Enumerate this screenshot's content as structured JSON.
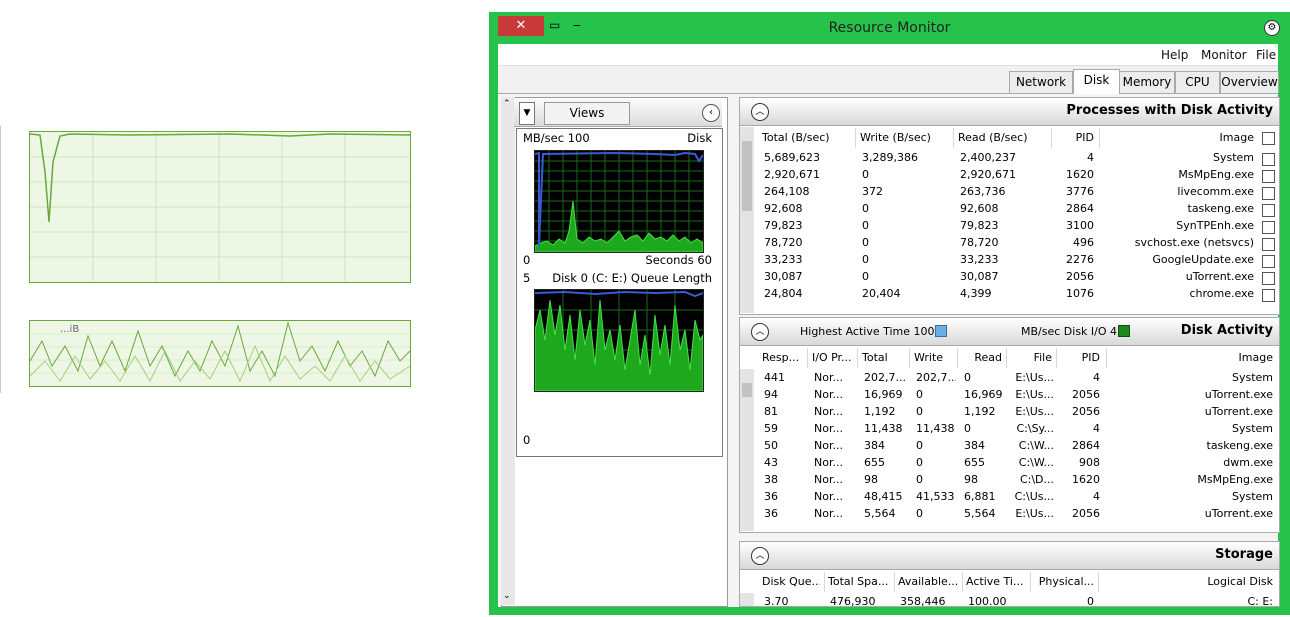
{
  "window": {
    "title": "Resource Monitor",
    "close_icon": "✕",
    "restore_icon": "▭",
    "minimize_icon": "‒"
  },
  "menu": [
    {
      "label": "File"
    },
    {
      "label": "Monitor"
    },
    {
      "label": "Help"
    }
  ],
  "tabs": [
    {
      "label": "Overview"
    },
    {
      "label": "CPU"
    },
    {
      "label": "Memory"
    },
    {
      "label": "Disk",
      "active": true
    },
    {
      "label": "Network"
    }
  ],
  "left_pane": {
    "views_label": "Views",
    "graph1": {
      "title": "Disk",
      "scale": "MB/sec 100",
      "bottom_left": "0",
      "bottom_right": "Seconds 60"
    },
    "graph2": {
      "title": "Disk 0 (C: E:) Queue Length",
      "scale": "5",
      "bottom_left": "0"
    }
  },
  "background": {
    "partial_text": "...iB"
  },
  "processes": {
    "title": "Processes with Disk Activity",
    "columns": [
      "Image",
      "PID",
      "Read (B/sec)",
      "Write (B/sec)",
      "Total (B/sec)"
    ],
    "rows": [
      {
        "image": "System",
        "pid": "4",
        "read": "2,400,237",
        "write": "3,289,386",
        "total": "5,689,623"
      },
      {
        "image": "MsMpEng.exe",
        "pid": "1620",
        "read": "2,920,671",
        "write": "0",
        "total": "2,920,671"
      },
      {
        "image": "livecomm.exe",
        "pid": "3776",
        "read": "263,736",
        "write": "372",
        "total": "264,108"
      },
      {
        "image": "taskeng.exe",
        "pid": "2864",
        "read": "92,608",
        "write": "0",
        "total": "92,608"
      },
      {
        "image": "SynTPEnh.exe",
        "pid": "3100",
        "read": "79,823",
        "write": "0",
        "total": "79,823"
      },
      {
        "image": "svchost.exe (netsvcs)",
        "pid": "496",
        "read": "78,720",
        "write": "0",
        "total": "78,720"
      },
      {
        "image": "GoogleUpdate.exe",
        "pid": "2276",
        "read": "33,233",
        "write": "0",
        "total": "33,233"
      },
      {
        "image": "uTorrent.exe",
        "pid": "2056",
        "read": "30,087",
        "write": "0",
        "total": "30,087"
      },
      {
        "image": "chrome.exe",
        "pid": "1076",
        "read": "4,399",
        "write": "20,404",
        "total": "24,804"
      }
    ]
  },
  "disk_activity": {
    "title": "Disk Activity",
    "highest_active": "Highest Active Time 100%",
    "io_label": "MB/sec Disk I/O 4",
    "columns": [
      "Image",
      "PID",
      "File",
      "Read",
      "Write",
      "Total",
      "I/O Pr...",
      "Resp..."
    ],
    "rows": [
      {
        "image": "System",
        "pid": "4",
        "file": "E:\\Us...",
        "read": "0",
        "write": "202,7...",
        "total": "202,7...",
        "prio": "Nor...",
        "resp": "441"
      },
      {
        "image": "uTorrent.exe",
        "pid": "2056",
        "file": "E:\\Us...",
        "read": "16,969",
        "write": "0",
        "total": "16,969",
        "prio": "Nor...",
        "resp": "94"
      },
      {
        "image": "uTorrent.exe",
        "pid": "2056",
        "file": "E:\\Us...",
        "read": "1,192",
        "write": "0",
        "total": "1,192",
        "prio": "Nor...",
        "resp": "81"
      },
      {
        "image": "System",
        "pid": "4",
        "file": "C:\\Sy...",
        "read": "0",
        "write": "11,438",
        "total": "11,438",
        "prio": "Nor...",
        "resp": "59"
      },
      {
        "image": "taskeng.exe",
        "pid": "2864",
        "file": "C:\\W...",
        "read": "384",
        "write": "0",
        "total": "384",
        "prio": "Nor...",
        "resp": "50"
      },
      {
        "image": "dwm.exe",
        "pid": "908",
        "file": "C:\\W...",
        "read": "655",
        "write": "0",
        "total": "655",
        "prio": "Nor...",
        "resp": "43"
      },
      {
        "image": "MsMpEng.exe",
        "pid": "1620",
        "file": "C:\\D...",
        "read": "98",
        "write": "0",
        "total": "98",
        "prio": "Nor...",
        "resp": "38"
      },
      {
        "image": "System",
        "pid": "4",
        "file": "C:\\Us...",
        "read": "6,881",
        "write": "41,533",
        "total": "48,415",
        "prio": "Nor...",
        "resp": "36"
      },
      {
        "image": "uTorrent.exe",
        "pid": "2056",
        "file": "E:\\Us...",
        "read": "5,564",
        "write": "0",
        "total": "5,564",
        "prio": "Nor...",
        "resp": "36"
      }
    ]
  },
  "storage": {
    "title": "Storage",
    "columns": [
      "Logical Disk",
      "Physical...",
      "Active Ti...",
      "Available...",
      "Total Spa...",
      "Disk Que..."
    ],
    "row": {
      "logical": "C: E:",
      "physical": "0",
      "active": "100.00",
      "available": "358,446",
      "total": "476,930",
      "queue": "3.70"
    }
  },
  "colors": {
    "frame": "#27c24c",
    "graph_line": "#3cc23c",
    "graph_max": "#3a5bd6",
    "close": "#c8393a"
  }
}
